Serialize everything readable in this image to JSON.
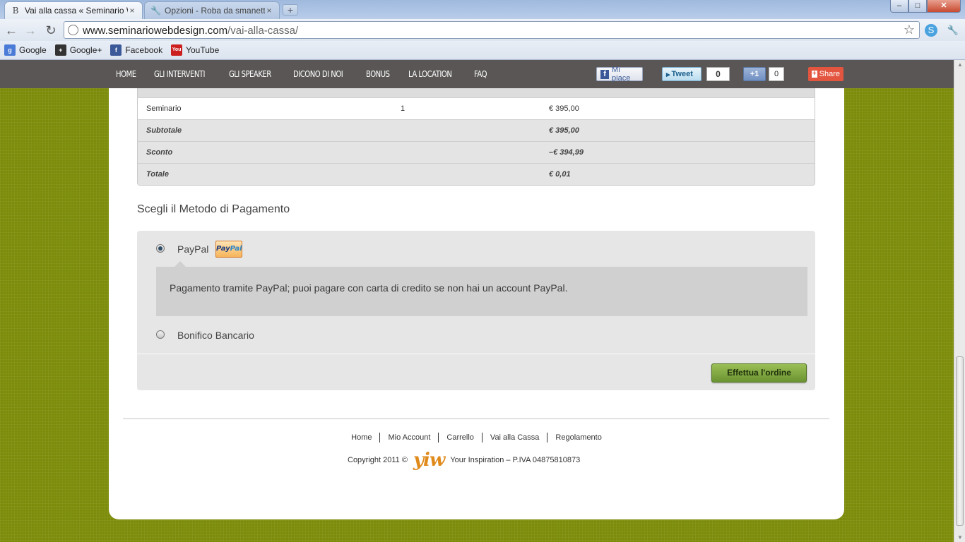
{
  "browser": {
    "tabs": [
      {
        "title": "Vai alla cassa « Seminario W",
        "favicon": "B",
        "close": "×"
      },
      {
        "title": "Opzioni - Roba da smanetto",
        "favicon": "🔧",
        "close": "×"
      }
    ],
    "new_tab": "+",
    "window_controls": {
      "minimize": "–",
      "maximize": "□",
      "close": "✕"
    },
    "nav": {
      "back": "←",
      "forward": "→",
      "reload": "↻"
    },
    "url_host": "www.seminariowebdesign.com",
    "url_path": "/vai-alla-cassa/",
    "bookmark_star": "☆",
    "wrench": "🔧",
    "bookmarks": [
      {
        "label": "Google",
        "icon_text": "g",
        "color": "#4a7bd6"
      },
      {
        "label": "Google+",
        "icon_text": "+",
        "color": "#333333"
      },
      {
        "label": "Facebook",
        "icon_text": "f",
        "color": "#3b5998"
      },
      {
        "label": "YouTube",
        "icon_text": "You",
        "color": "#cc2020"
      }
    ]
  },
  "site_nav": {
    "items": [
      "HOME",
      "GLI INTERVENTI",
      "GLI SPEAKER",
      "DICONO DI NOI",
      "BONUS",
      "LA LOCATION",
      "FAQ"
    ]
  },
  "social": {
    "fb_icon": "f",
    "fb_like": "Mi piace",
    "tweet": "Tweet",
    "tweet_count": "0",
    "gplus": "+1",
    "gplus_count": "0",
    "share_icon": "+",
    "share": "Share"
  },
  "order": {
    "item": {
      "name": "Seminario",
      "qty": "1",
      "price": "€ 395,00"
    },
    "subtotal": {
      "label": "Subtotale",
      "value": "€ 395,00"
    },
    "discount": {
      "label": "Sconto",
      "value": "–€ 394,99"
    },
    "total": {
      "label": "Totale",
      "value": "€ 0,01"
    }
  },
  "payment": {
    "title": "Scegli il Metodo di Pagamento",
    "paypal_label": "PayPal",
    "paypal_logo_a": "Pay",
    "paypal_logo_b": "Pal",
    "paypal_description": "Pagamento tramite PayPal; puoi pagare con carta di credito se non hai un account PayPal.",
    "bank_label": "Bonifico Bancario",
    "selected": "PayPal",
    "submit": "Effettua l'ordine"
  },
  "footer": {
    "links": [
      "Home",
      "Mio Account",
      "Carrello",
      "Vai alla Cassa",
      "Regolamento"
    ],
    "copyright": "Copyright 2011 ©",
    "logo": "yiw",
    "company": "Your Inspiration – P.IVA 04875810873"
  },
  "colors": {
    "background": "#7c8c0a",
    "nav": "#5a5656",
    "button": "#7ea63f",
    "paypal_accent": "#f7b45a"
  }
}
